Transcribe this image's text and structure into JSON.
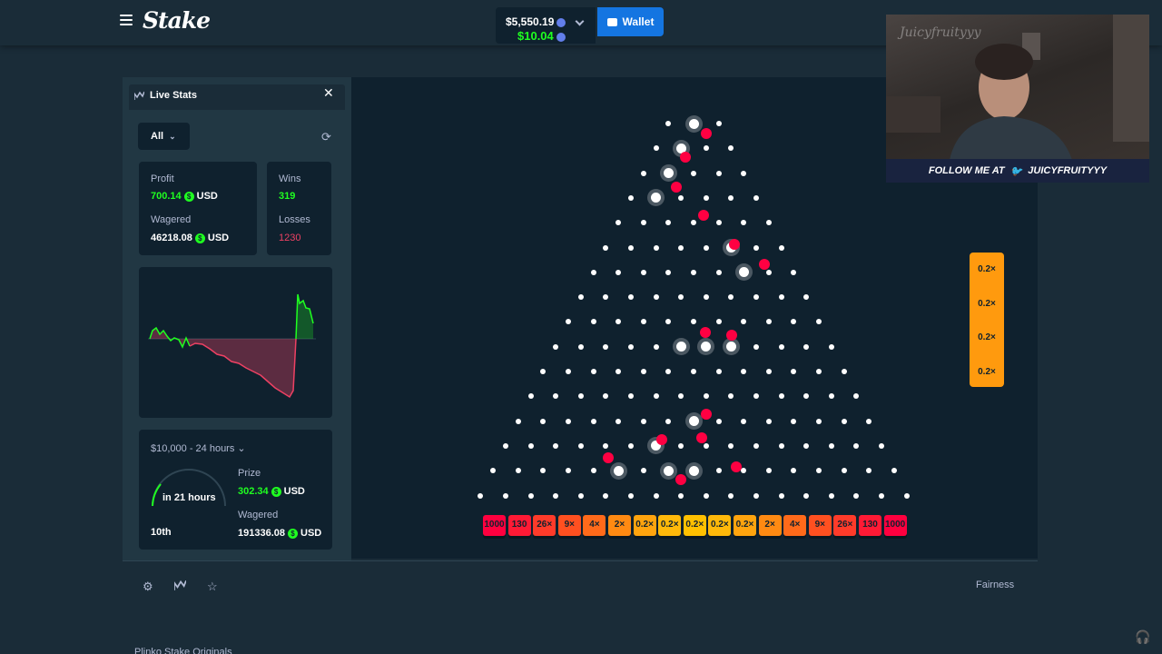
{
  "header": {
    "logo": "Stake",
    "balance": "$5,550.19",
    "sub_balance": "$10.04",
    "wallet_label": "Wallet"
  },
  "live_stats": {
    "title": "Live Stats",
    "filter": "All",
    "profit_label": "Profit",
    "profit_value": "700.14",
    "wagered_label": "Wagered",
    "wagered_value": "46218.08",
    "currency": "USD",
    "wins_label": "Wins",
    "wins_value": "319",
    "losses_label": "Losses",
    "losses_value": "1230"
  },
  "race": {
    "title": "$10,000 - 24 hours",
    "countdown": "in 21 hours",
    "rank": "10th",
    "prize_label": "Prize",
    "prize_value": "302.34",
    "wagered_label": "Wagered",
    "wagered_value": "191336.08",
    "currency": "USD"
  },
  "plinko": {
    "rows": 16,
    "multipliers": [
      "1000",
      "130",
      "26×",
      "9×",
      "4×",
      "2×",
      "0.2×",
      "0.2×",
      "0.2×",
      "0.2×",
      "0.2×",
      "2×",
      "4×",
      "9×",
      "26×",
      "130",
      "1000"
    ],
    "recent_payouts": [
      "0.2×",
      "0.2×",
      "0.2×",
      "0.2×"
    ]
  },
  "footer": {
    "fairness": "Fairness",
    "below_text": "Plinko  Stake Originals"
  },
  "webcam": {
    "watermark": "Juicyfruityyy",
    "banner": "FOLLOW ME AT",
    "handle": "JUICYFRUITYYY"
  },
  "colors": {
    "bg": "#1a2c38",
    "game_bg": "#0f212e",
    "accent_blue": "#1475e1",
    "green": "#1fff20",
    "red": "#ed4163",
    "ball": "#ff0042"
  }
}
